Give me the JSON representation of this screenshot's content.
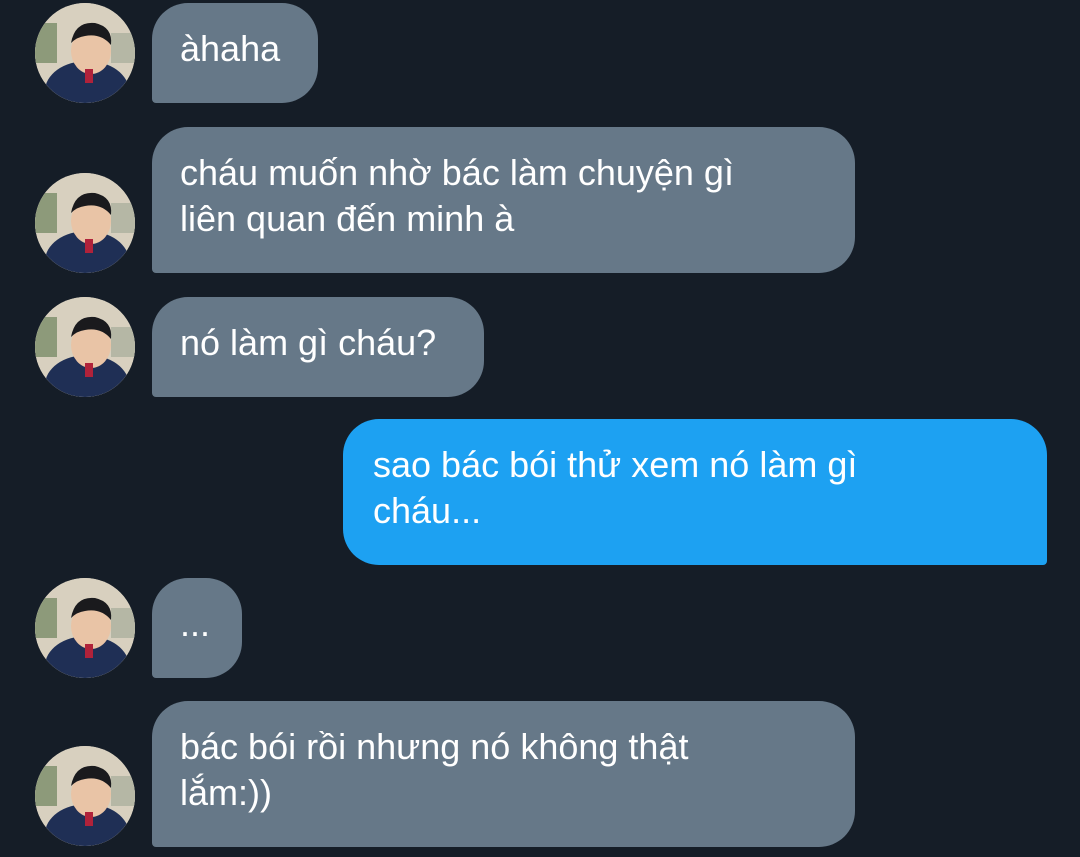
{
  "colors": {
    "background": "#151d27",
    "incoming_bubble": "#667888",
    "outgoing_bubble": "#1da1f2",
    "text": "#ffffff"
  },
  "messages": [
    {
      "sender": "them",
      "text": "àhaha"
    },
    {
      "sender": "them",
      "text": "cháu muốn nhờ bác làm chuyện gì\nliên quan đến minh à"
    },
    {
      "sender": "them",
      "text": "nó làm gì cháu?"
    },
    {
      "sender": "me",
      "text": "sao bác bói thử xem nó làm gì\ncháu..."
    },
    {
      "sender": "them",
      "text": "..."
    },
    {
      "sender": "them",
      "text": "bác bói rồi nhưng nó không thật\nlắm:))"
    }
  ],
  "avatar": {
    "icon": "profile-photo-boy"
  }
}
